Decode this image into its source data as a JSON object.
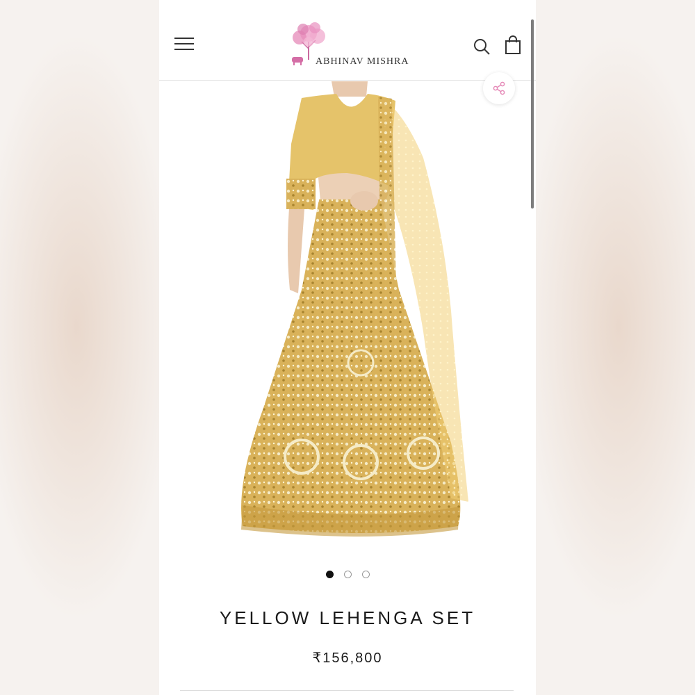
{
  "header": {
    "brand_name": "ABHINAV MISHRA",
    "icons": [
      "menu-icon",
      "search-icon",
      "shopping-bag-icon"
    ]
  },
  "product": {
    "title": "YELLOW LEHENGA SET",
    "price": "₹156,800",
    "image_alt": "Yellow lehenga with mirror work and net dupatta",
    "gallery": {
      "total": 3,
      "active_index": 0
    }
  },
  "actions": {
    "share_icon": "share-icon"
  },
  "colors": {
    "page_bg": "#ffffff",
    "text": "#1a1a1a",
    "lehenga": "#d9b25a",
    "logo_pink": "#e58ab8"
  }
}
